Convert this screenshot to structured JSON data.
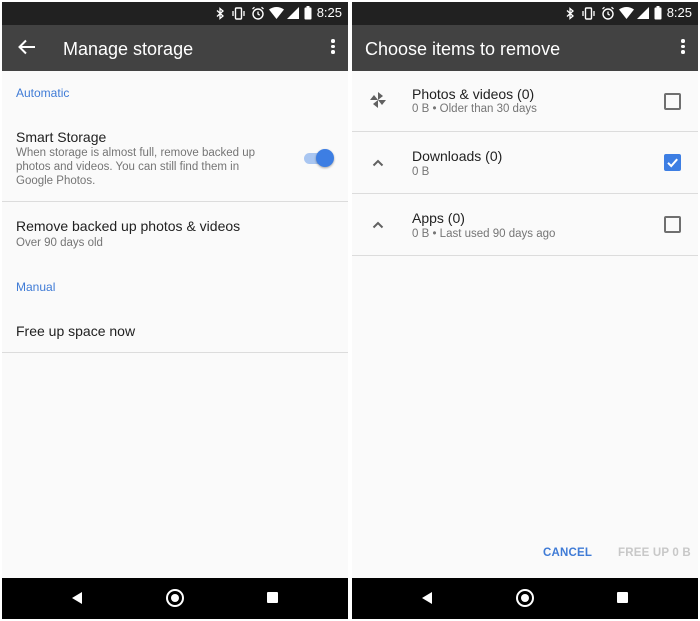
{
  "status_bar": {
    "time": "8:25"
  },
  "left_screen": {
    "title": "Manage storage",
    "sections": {
      "automatic": "Automatic",
      "manual": "Manual"
    },
    "smart_storage": {
      "title": "Smart Storage",
      "description_lines": [
        "When storage is almost full, remove backed up",
        "photos and videos. You can still find them in",
        "Google Photos."
      ],
      "enabled": true
    },
    "remove_backed_up": {
      "title": "Remove backed up photos & videos",
      "subtitle": "Over 90 days old"
    },
    "free_up_space": {
      "title": "Free up space now"
    }
  },
  "right_screen": {
    "title": "Choose items to remove",
    "items": [
      {
        "icon": "pinwheel-icon",
        "title": "Photos & videos (0)",
        "subtitle": "0 B • Older than 30 days",
        "checked": false
      },
      {
        "icon": "chevron-up-icon",
        "title": "Downloads (0)",
        "subtitle": "0 B",
        "checked": true
      },
      {
        "icon": "chevron-up-icon",
        "title": "Apps (0)",
        "subtitle": "0 B • Last used 90 days ago",
        "checked": false
      }
    ],
    "actions": {
      "cancel": "CANCEL",
      "free_up": "FREE UP 0 B"
    }
  },
  "colors": {
    "accent_blue": "#3d7ee3",
    "section_header_blue": "#3f7bd6",
    "app_bar": "#424242",
    "status_bar": "#212121",
    "nav_bar": "#000000",
    "disabled_text": "#c8c8c8"
  }
}
